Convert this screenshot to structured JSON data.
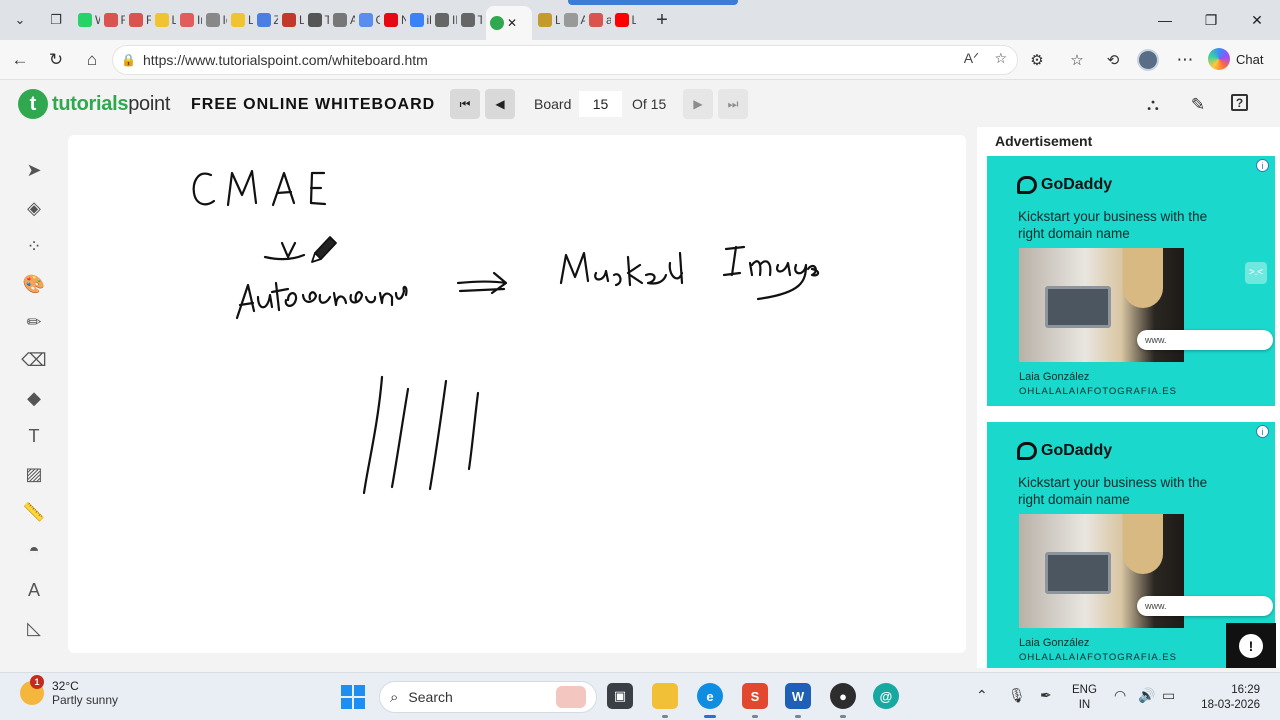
{
  "browser": {
    "tabs": [
      {
        "label": "Wh",
        "color": "#25d366"
      },
      {
        "label": "Re",
        "color": "#d9534f"
      },
      {
        "label": "Re",
        "color": "#d9534f"
      },
      {
        "label": "Lo",
        "color": "#f0c330"
      },
      {
        "label": "Int",
        "color": "#e25c5c"
      },
      {
        "label": "Ide",
        "color": "#888888"
      },
      {
        "label": "Le",
        "color": "#f0c330"
      },
      {
        "label": "Zo",
        "color": "#4a7ee3"
      },
      {
        "label": "Le",
        "color": "#c0392b"
      },
      {
        "label": "Th",
        "color": "#555555"
      },
      {
        "label": "A I",
        "color": "#777777"
      },
      {
        "label": "Go",
        "color": "#5b8def"
      },
      {
        "label": "Ne",
        "color": "#e50914"
      },
      {
        "label": "ibr",
        "color": "#3b82f6"
      },
      {
        "label": "IBI",
        "color": "#666666"
      },
      {
        "label": "Tra",
        "color": "#666666"
      }
    ],
    "active_tab_close": "✕",
    "tabs_after": [
      {
        "label": "Lir",
        "color": "#c49a2c"
      },
      {
        "label": "Ar",
        "color": "#999999"
      },
      {
        "label": "art",
        "color": "#d9534f"
      },
      {
        "label": "Liv",
        "color": "#ff0000"
      }
    ],
    "new_tab": "+",
    "url": "https://www.tutorialspoint.com/whiteboard.htm",
    "chat_label": "Chat"
  },
  "site": {
    "logo_brand": "tutorials",
    "logo_rest": "point",
    "logo_mark": "t",
    "app_title": "FREE ONLINE WHITEBOARD",
    "board_label": "Board",
    "board_current": "15",
    "board_of": "Of 15"
  },
  "toolbar": {
    "tools": [
      {
        "name": "select-tool",
        "icon": "cursor-icon",
        "glyph": "➤"
      },
      {
        "name": "layers-tool",
        "icon": "layers-icon",
        "glyph": "◈"
      },
      {
        "name": "grid-tool",
        "icon": "grid-icon",
        "glyph": "⁘"
      },
      {
        "name": "palette-tool",
        "icon": "palette-icon",
        "glyph": "🎨"
      },
      {
        "name": "pencil-tool",
        "icon": "pencil-icon",
        "glyph": "✏"
      },
      {
        "name": "eraser-tool",
        "icon": "eraser-icon",
        "glyph": "⌫"
      },
      {
        "name": "shapes-tool",
        "icon": "shapes-icon",
        "glyph": "◆"
      },
      {
        "name": "text-tool",
        "icon": "text-icon",
        "glyph": "T"
      },
      {
        "name": "image-tool",
        "icon": "image-icon",
        "glyph": "▨"
      },
      {
        "name": "ruler-tool",
        "icon": "ruler-icon",
        "glyph": "📏"
      },
      {
        "name": "protractor-tool",
        "icon": "protractor-icon",
        "glyph": "◓"
      },
      {
        "name": "compass-tool",
        "icon": "compass-icon",
        "glyph": "A"
      },
      {
        "name": "setsquare-tool",
        "icon": "setsquare-icon",
        "glyph": "◺"
      }
    ]
  },
  "canvas": {
    "strokes": [
      "CMAE",
      "Autoencoders",
      "Masked",
      "Image"
    ]
  },
  "ads": {
    "title": "Advertisement",
    "info": "i",
    "items": [
      {
        "brand": "GoDaddy",
        "headline": "Kickstart your business with the right domain name",
        "pill": "www.",
        "person": "Laia González",
        "domain": "OHLALALAIAFOTOGRAFIA.ES"
      },
      {
        "brand": "GoDaddy",
        "headline": "Kickstart your business with the right domain name",
        "pill": "www.",
        "person": "Laia González",
        "domain": "OHLALALAIAFOTOGRAFIA.ES"
      }
    ],
    "side_mark": ">.<",
    "feedback": "!"
  },
  "taskbar": {
    "weather_temp": "32°C",
    "weather_desc": "Partly sunny",
    "weather_badge": "1",
    "search_label": "Search",
    "lang_line1": "ENG",
    "lang_line2": "IN",
    "time": "16:29",
    "date": "18-03-2026"
  }
}
